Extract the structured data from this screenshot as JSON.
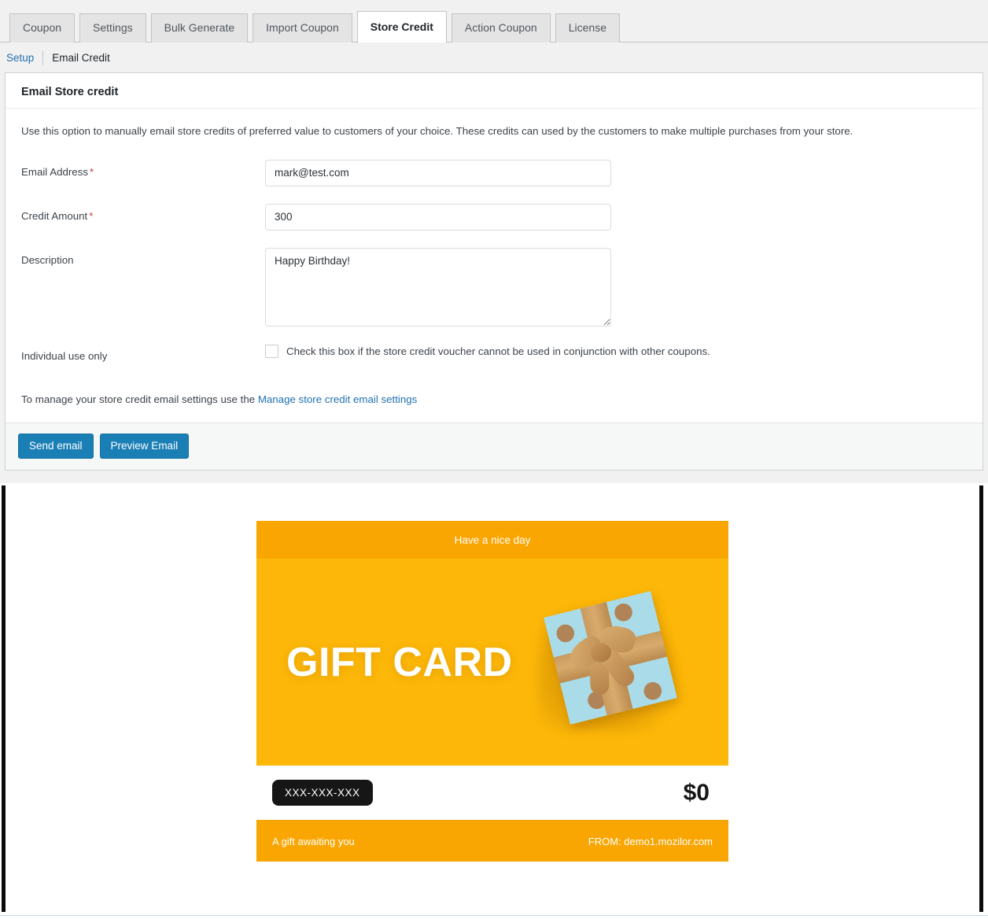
{
  "tabs": [
    {
      "label": "Coupon",
      "active": false
    },
    {
      "label": "Settings",
      "active": false
    },
    {
      "label": "Bulk Generate",
      "active": false
    },
    {
      "label": "Import Coupon",
      "active": false
    },
    {
      "label": "Store Credit",
      "active": true
    },
    {
      "label": "Action Coupon",
      "active": false
    },
    {
      "label": "License",
      "active": false
    }
  ],
  "subnav": {
    "setup": "Setup",
    "email_credit": "Email Credit"
  },
  "panel": {
    "title": "Email Store credit",
    "intro": "Use this option to manually email store credits of preferred value to customers of your choice. These credits can used by the customers to make multiple purchases from your store.",
    "fields": {
      "email": {
        "label": "Email Address",
        "required": "*",
        "value": "mark@test.com",
        "placeholder": ""
      },
      "amount": {
        "label": "Credit Amount",
        "required": "*",
        "value": "300",
        "placeholder": ""
      },
      "description": {
        "label": "Description",
        "value": "Happy Birthday!",
        "placeholder": ""
      },
      "individual_use": {
        "label": "Individual use only",
        "checkbox_text": "Check this box if the store credit voucher cannot be used in conjunction with other coupons.",
        "checked": false
      }
    },
    "manage": {
      "prefix": "To manage your store credit email settings use the ",
      "link": "Manage store credit email settings"
    },
    "footer": {
      "send": "Send email",
      "preview": "Preview Email"
    }
  },
  "giftcard": {
    "banner": "Have a nice day",
    "hero_title": "GIFT CARD",
    "code": "XXX-XXX-XXX",
    "amount": "$0",
    "footer_left": "A gift awaiting you",
    "footer_right": "FROM: demo1.mozilor.com"
  },
  "colors": {
    "accent_blue": "#1a7fb5",
    "link_blue": "#2271b1",
    "required_red": "#d63638",
    "card_banner_orange": "#f9a603",
    "card_body_orange": "#fcb708",
    "code_badge_black": "#161616"
  }
}
